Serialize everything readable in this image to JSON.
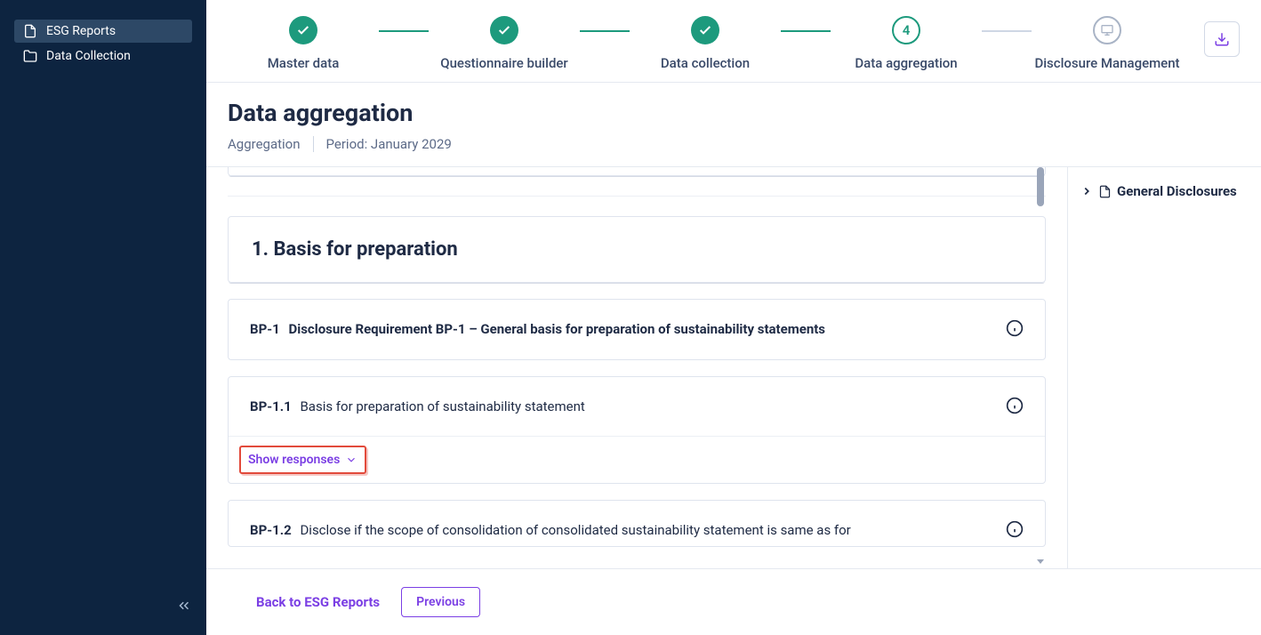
{
  "sidebar": {
    "items": [
      {
        "label": "ESG Reports",
        "icon": "file"
      },
      {
        "label": "Data Collection",
        "icon": "folder"
      }
    ]
  },
  "stepper": {
    "steps": [
      {
        "label": "Master data",
        "state": "done"
      },
      {
        "label": "Questionnaire builder",
        "state": "done"
      },
      {
        "label": "Data collection",
        "state": "done"
      },
      {
        "label": "Data aggregation",
        "state": "active",
        "num": "4"
      },
      {
        "label": "Disclosure Management",
        "state": "pending"
      }
    ]
  },
  "header": {
    "title": "Data aggregation",
    "crumb": "Aggregation",
    "period": "Period: January 2029"
  },
  "section": {
    "title": "1. Basis for preparation"
  },
  "reqs": [
    {
      "code": "BP-1",
      "text": "Disclosure Requirement BP-1 – General basis for preparation of sustainability statements"
    },
    {
      "code": "BP-1.1",
      "text": "Basis for preparation of sustainability statement"
    },
    {
      "code": "BP-1.2",
      "text": "Disclose if the scope of consolidation of consolidated sustainability statement is same as for"
    }
  ],
  "show_responses_label": "Show responses",
  "side": {
    "item": "General Disclosures"
  },
  "footer": {
    "back": "Back to ESG Reports",
    "prev": "Previous"
  }
}
